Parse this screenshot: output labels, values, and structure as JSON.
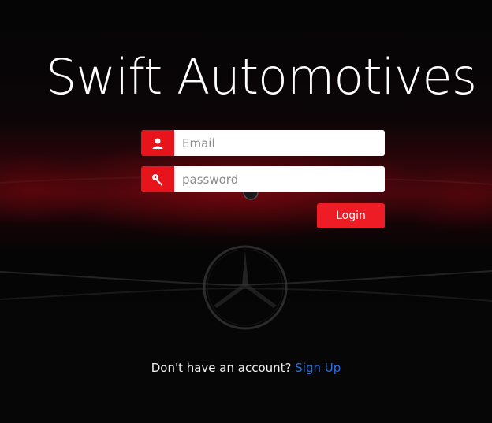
{
  "app": {
    "title": "Swift Automotives"
  },
  "form": {
    "email": {
      "placeholder": "Email",
      "value": "",
      "icon": "user-icon"
    },
    "password": {
      "placeholder": "password",
      "value": "",
      "icon": "key-icon"
    },
    "login_label": "Login"
  },
  "footer": {
    "prompt": "Don't have an account?",
    "signup_label": "Sign Up"
  },
  "colors": {
    "accent": "#ee1c24",
    "link": "#2a6fe0",
    "background": "#000000"
  }
}
